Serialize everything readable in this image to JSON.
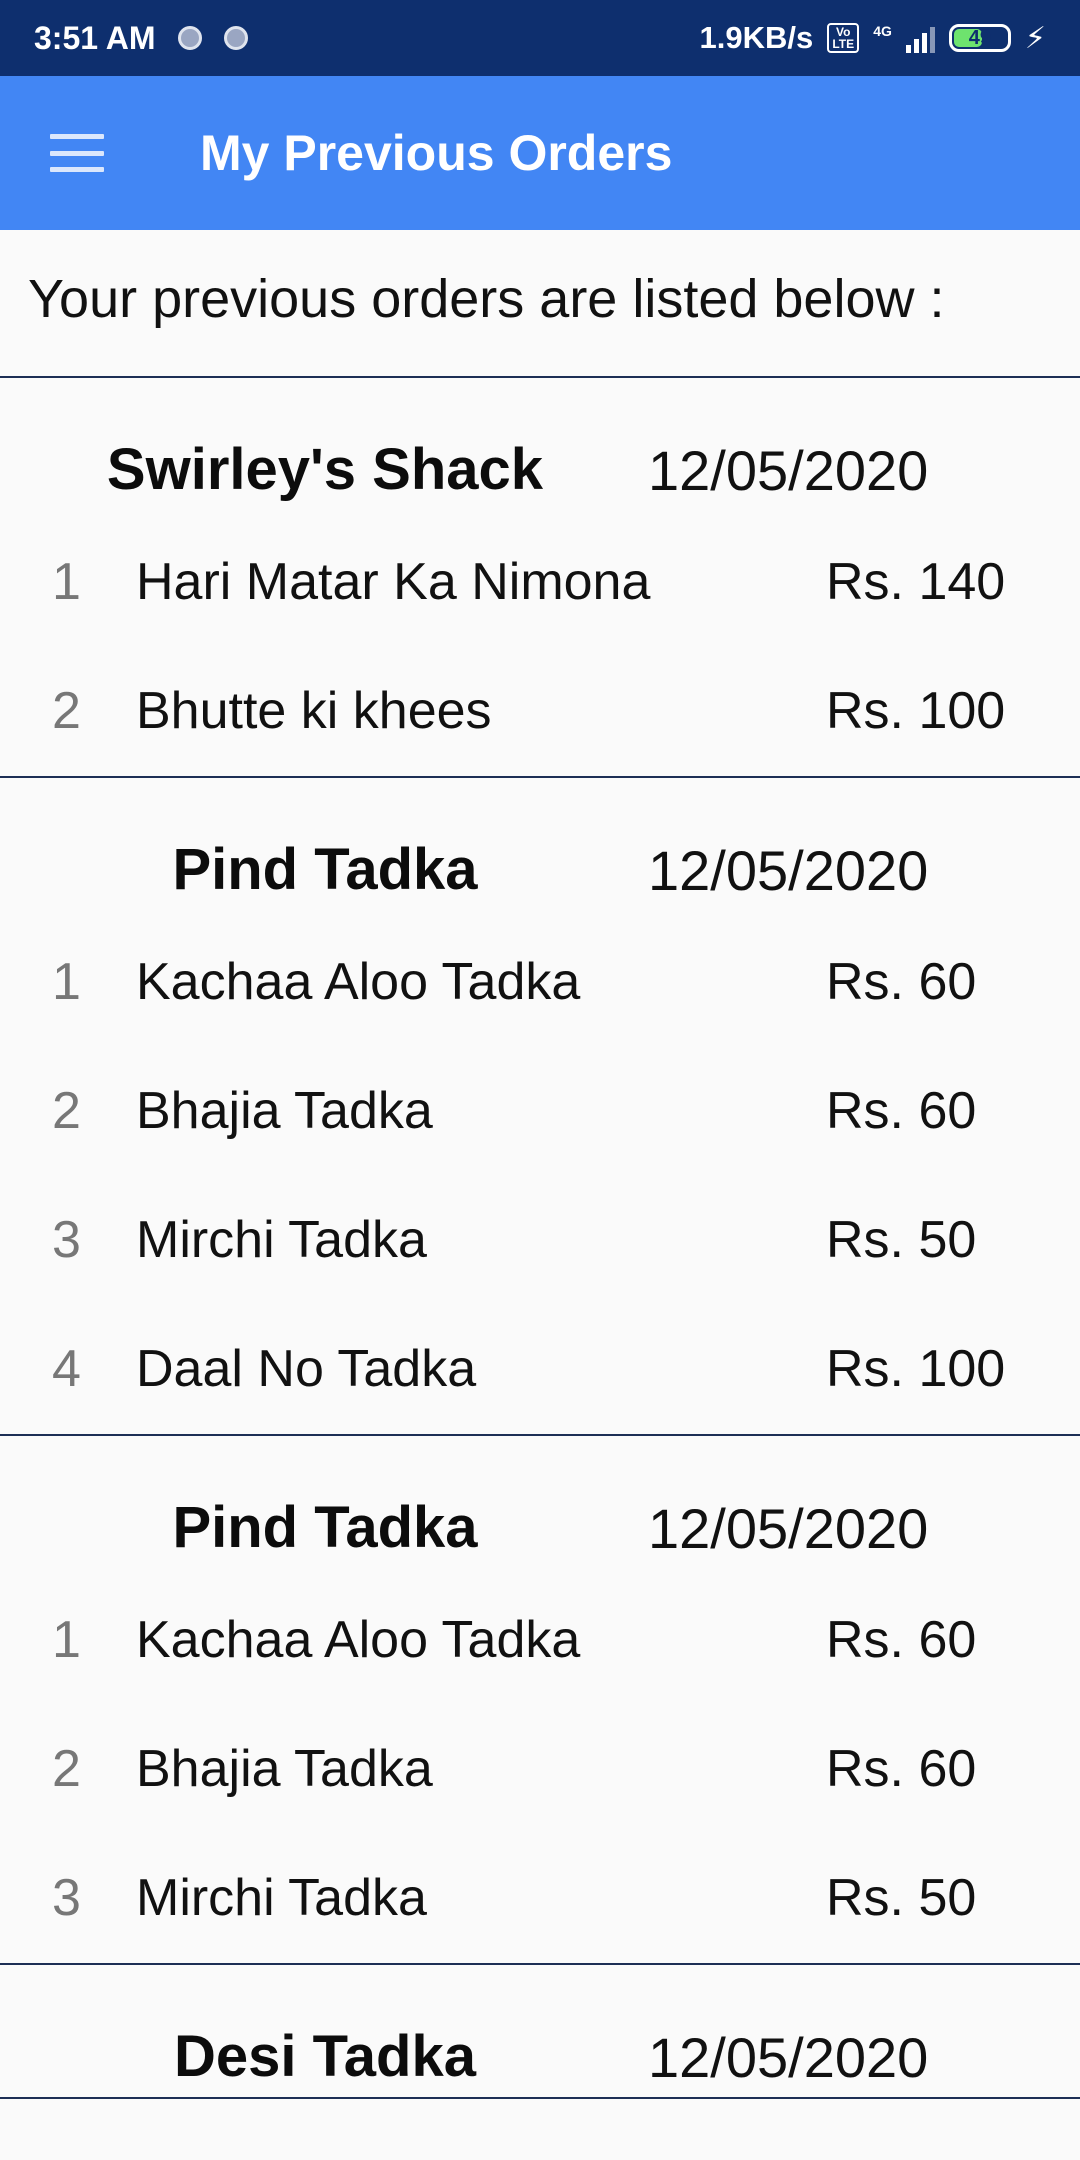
{
  "status_bar": {
    "time": "3:51 AM",
    "network_speed": "1.9KB/s",
    "volte_label": "Vo LTE",
    "network_type": "4G",
    "battery_level": "49",
    "icons": [
      "notification-dot-icon",
      "notification-dot-icon",
      "volte-icon",
      "signal-icon",
      "battery-icon",
      "charging-bolt-icon"
    ]
  },
  "app_bar": {
    "title": "My Previous Orders",
    "menu_icon": "hamburger-menu-icon",
    "background_color": "#4286f4"
  },
  "intro_text": "Your previous orders are listed below :",
  "orders": [
    {
      "restaurant": "Swirley's Shack",
      "date": "12/05/2020",
      "items": [
        {
          "num": "1",
          "name": "Hari Matar Ka Nimona",
          "price": "Rs. 140"
        },
        {
          "num": "2",
          "name": "Bhutte ki khees",
          "price": "Rs. 100"
        }
      ]
    },
    {
      "restaurant": "Pind Tadka",
      "date": "12/05/2020",
      "items": [
        {
          "num": "1",
          "name": "Kachaa Aloo Tadka",
          "price": "Rs. 60"
        },
        {
          "num": "2",
          "name": "Bhajia Tadka",
          "price": "Rs. 60"
        },
        {
          "num": "3",
          "name": "Mirchi Tadka",
          "price": "Rs. 50"
        },
        {
          "num": "4",
          "name": "Daal No Tadka",
          "price": "Rs. 100"
        }
      ]
    },
    {
      "restaurant": "Pind Tadka",
      "date": "12/05/2020",
      "items": [
        {
          "num": "1",
          "name": "Kachaa Aloo Tadka",
          "price": "Rs. 60"
        },
        {
          "num": "2",
          "name": "Bhajia Tadka",
          "price": "Rs. 60"
        },
        {
          "num": "3",
          "name": "Mirchi Tadka",
          "price": "Rs. 50"
        }
      ]
    },
    {
      "restaurant": "Desi Tadka",
      "date": "12/05/2020",
      "items": []
    }
  ],
  "colors": {
    "status_bar": "#0e2f6e",
    "divider": "#1d2f55",
    "background": "#fafafa"
  }
}
